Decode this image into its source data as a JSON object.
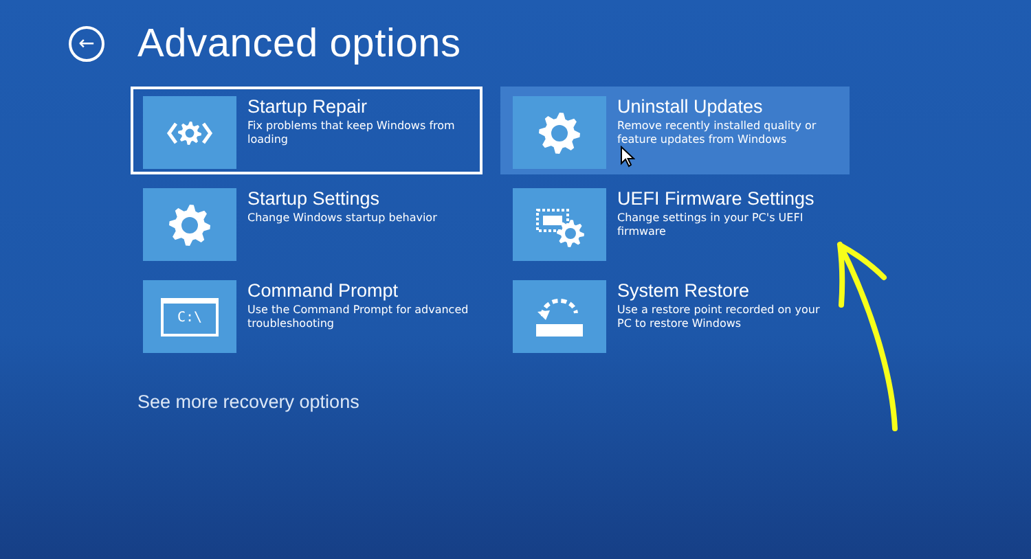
{
  "header": {
    "back_button": "←",
    "title": "Advanced options"
  },
  "options": [
    {
      "kind": "repair",
      "title": "Startup Repair",
      "description": "Fix problems that keep Windows from loading",
      "selected": true,
      "hovered": false
    },
    {
      "kind": "gear",
      "title": "Uninstall Updates",
      "description": "Remove recently installed quality or feature updates from Windows",
      "selected": false,
      "hovered": true
    },
    {
      "kind": "gear",
      "title": "Startup Settings",
      "description": "Change Windows startup behavior",
      "selected": false,
      "hovered": false
    },
    {
      "kind": "chip",
      "title": "UEFI Firmware Settings",
      "description": "Change settings in your PC's UEFI firmware",
      "selected": false,
      "hovered": false
    },
    {
      "kind": "prompt",
      "title": "Command Prompt",
      "description": "Use the Command Prompt for advanced troubleshooting",
      "selected": false,
      "hovered": false
    },
    {
      "kind": "restore",
      "title": "System Restore",
      "description": "Use a restore point recorded on your PC to restore Windows",
      "selected": false,
      "hovered": false
    }
  ],
  "prompt_icon_text": "C:\\",
  "more_link": "See more recovery options"
}
